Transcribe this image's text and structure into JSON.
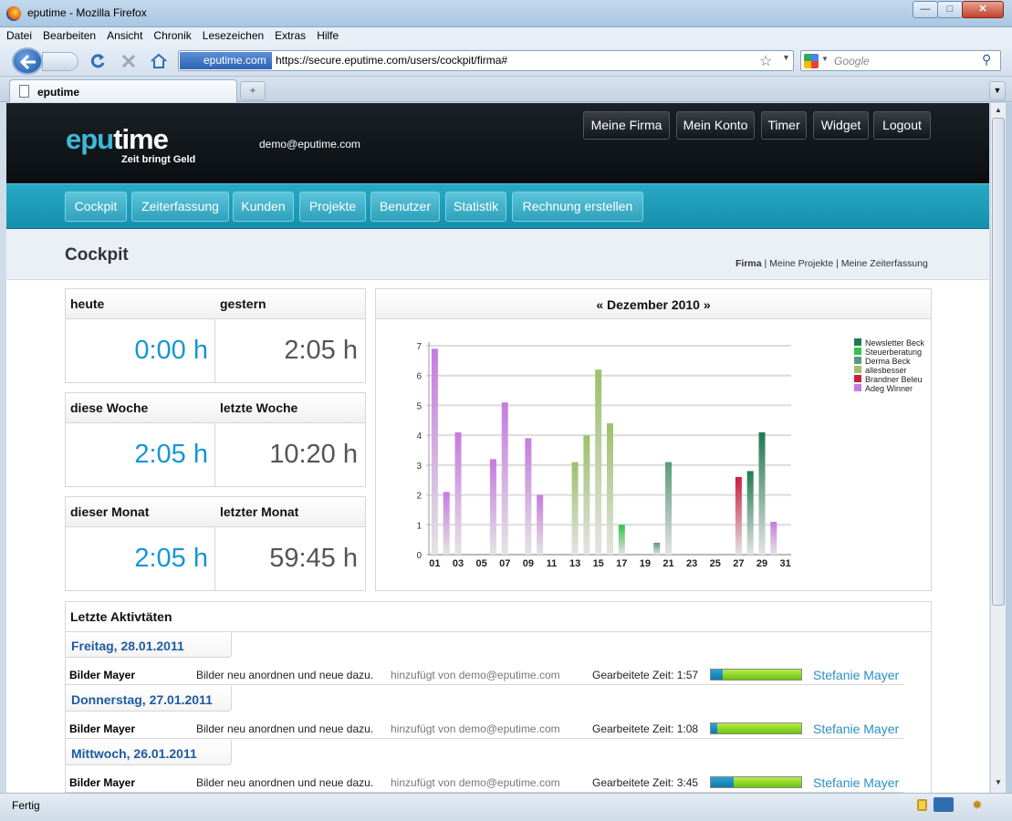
{
  "window": {
    "title": "eputime - Mozilla Firefox"
  },
  "menu": [
    "Datei",
    "Bearbeiten",
    "Ansicht",
    "Chronik",
    "Lesezeichen",
    "Extras",
    "Hilfe"
  ],
  "address": {
    "site": "eputime.com",
    "url": "https://secure.eputime.com/users/cockpit/firma#"
  },
  "search": {
    "placeholder": "Google"
  },
  "tab": {
    "title": "eputime"
  },
  "site": {
    "logo_a": "epu",
    "logo_b": "time",
    "slogan": "Zeit bringt Geld",
    "email": "demo@eputime.com"
  },
  "topnav": [
    "Meine Firma",
    "Mein Konto",
    "Timer",
    "Widget",
    "Logout"
  ],
  "mainnav": [
    "Cockpit",
    "Zeiterfassung",
    "Kunden",
    "Projekte",
    "Benutzer",
    "Statistik",
    "Rechnung erstellen"
  ],
  "page": {
    "title": "Cockpit"
  },
  "subnav": {
    "firma": "Firma",
    "sep1": " | ",
    "projekte": "Meine Projekte",
    "sep2": " | ",
    "zeiterfassung": "Meine Zeiterfassung"
  },
  "stats": [
    {
      "cur_label": "heute",
      "cur_value": "0:00 h",
      "prev_label": "gestern",
      "prev_value": "2:05 h"
    },
    {
      "cur_label": "diese Woche",
      "cur_value": "2:05 h",
      "prev_label": "letzte Woche",
      "prev_value": "10:20 h"
    },
    {
      "cur_label": "dieser Monat",
      "cur_value": "2:05 h",
      "prev_label": "letzter Monat",
      "prev_value": "59:45 h"
    }
  ],
  "chart_title": "« Dezember 2010 »",
  "chart_data": {
    "type": "bar",
    "ylim": [
      0,
      7
    ],
    "yticks": [
      "0",
      "1",
      "2",
      "3",
      "4",
      "5",
      "6",
      "7"
    ],
    "xticks": [
      "01",
      "03",
      "05",
      "07",
      "09",
      "11",
      "13",
      "15",
      "17",
      "19",
      "21",
      "23",
      "25",
      "27",
      "29",
      "31"
    ],
    "legend_position": "right",
    "series": [
      {
        "name": "Newsletter Beck",
        "color": "#1f7a4f"
      },
      {
        "name": "Steuerberatung",
        "color": "#33c24a"
      },
      {
        "name": "Derma Beck",
        "color": "#5a9a7a"
      },
      {
        "name": "allesbesser",
        "color": "#9dc06a"
      },
      {
        "name": "Brandner Beleu",
        "color": "#c8203d"
      },
      {
        "name": "Adeg Winner",
        "color": "#c57be0"
      }
    ],
    "bars": [
      {
        "day": 1,
        "value": 6.9,
        "series": "Adeg Winner"
      },
      {
        "day": 2,
        "value": 2.1,
        "series": "Adeg Winner"
      },
      {
        "day": 3,
        "value": 4.1,
        "series": "Adeg Winner"
      },
      {
        "day": 6,
        "value": 3.2,
        "series": "Adeg Winner"
      },
      {
        "day": 7,
        "value": 5.1,
        "series": "Adeg Winner"
      },
      {
        "day": 9,
        "value": 3.9,
        "series": "Adeg Winner"
      },
      {
        "day": 10,
        "value": 2.0,
        "series": "Adeg Winner"
      },
      {
        "day": 13,
        "value": 3.1,
        "series": "allesbesser"
      },
      {
        "day": 14,
        "value": 4.0,
        "series": "allesbesser"
      },
      {
        "day": 15,
        "value": 6.2,
        "series": "allesbesser"
      },
      {
        "day": 16,
        "value": 4.4,
        "series": "allesbesser"
      },
      {
        "day": 17,
        "value": 1.0,
        "series": "Steuerberatung"
      },
      {
        "day": 20,
        "value": 0.4,
        "series": "Derma Beck"
      },
      {
        "day": 21,
        "value": 3.1,
        "series": "Derma Beck"
      },
      {
        "day": 27,
        "value": 2.6,
        "series": "Brandner Beleu"
      },
      {
        "day": 28,
        "value": 2.8,
        "series": "Newsletter Beck"
      },
      {
        "day": 29,
        "value": 4.1,
        "series": "Newsletter Beck"
      },
      {
        "day": 30,
        "value": 1.1,
        "series": "Adeg Winner"
      }
    ]
  },
  "activities": {
    "title": "Letzte Aktivtäten",
    "days": [
      {
        "date": "Freitag, 28.01.2011",
        "customer": "Bilder Mayer",
        "desc": "Bilder neu anordnen und neue dazu.",
        "added": "hinzufügt von demo@eputime.com",
        "worked": "Gearbeitete Zeit: 1:57",
        "progress": 0.13,
        "user": "Stefanie Mayer"
      },
      {
        "date": "Donnerstag, 27.01.2011",
        "customer": "Bilder Mayer",
        "desc": "Bilder neu anordnen und neue dazu.",
        "added": "hinzufügt von demo@eputime.com",
        "worked": "Gearbeitete Zeit: 1:08",
        "progress": 0.07,
        "user": "Stefanie Mayer"
      },
      {
        "date": "Mittwoch, 26.01.2011",
        "customer": "Bilder Mayer",
        "desc": "Bilder neu anordnen und neue dazu.",
        "added": "hinzufügt von demo@eputime.com",
        "worked": "Gearbeitete Zeit: 3:45",
        "progress": 0.25,
        "user": "Stefanie Mayer"
      }
    ]
  },
  "status": {
    "text": "Fertig"
  }
}
